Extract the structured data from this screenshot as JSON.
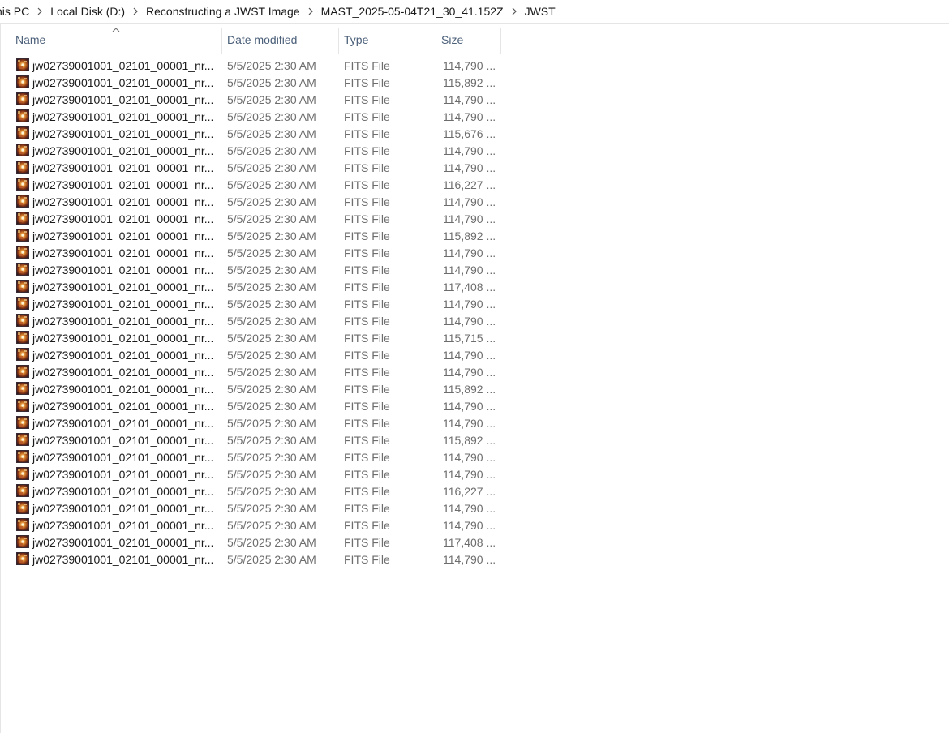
{
  "breadcrumb": [
    {
      "label": "his PC"
    },
    {
      "label": "Local Disk (D:)"
    },
    {
      "label": "Reconstructing a JWST Image"
    },
    {
      "label": "MAST_2025-05-04T21_30_41.152Z"
    },
    {
      "label": "JWST"
    }
  ],
  "columns": {
    "name": "Name",
    "date": "Date modified",
    "type": "Type",
    "size": "Size",
    "sort_indicator": "ascending"
  },
  "icon": "fits-file-icon",
  "files": [
    {
      "name": "jw02739001001_02101_00001_nr...",
      "date": "5/5/2025 2:30 AM",
      "type": "FITS File",
      "size": "114,790 ..."
    },
    {
      "name": "jw02739001001_02101_00001_nr...",
      "date": "5/5/2025 2:30 AM",
      "type": "FITS File",
      "size": "115,892 ..."
    },
    {
      "name": "jw02739001001_02101_00001_nr...",
      "date": "5/5/2025 2:30 AM",
      "type": "FITS File",
      "size": "114,790 ..."
    },
    {
      "name": "jw02739001001_02101_00001_nr...",
      "date": "5/5/2025 2:30 AM",
      "type": "FITS File",
      "size": "114,790 ..."
    },
    {
      "name": "jw02739001001_02101_00001_nr...",
      "date": "5/5/2025 2:30 AM",
      "type": "FITS File",
      "size": "115,676 ..."
    },
    {
      "name": "jw02739001001_02101_00001_nr...",
      "date": "5/5/2025 2:30 AM",
      "type": "FITS File",
      "size": "114,790 ..."
    },
    {
      "name": "jw02739001001_02101_00001_nr...",
      "date": "5/5/2025 2:30 AM",
      "type": "FITS File",
      "size": "114,790 ..."
    },
    {
      "name": "jw02739001001_02101_00001_nr...",
      "date": "5/5/2025 2:30 AM",
      "type": "FITS File",
      "size": "116,227 ..."
    },
    {
      "name": "jw02739001001_02101_00001_nr...",
      "date": "5/5/2025 2:30 AM",
      "type": "FITS File",
      "size": "114,790 ..."
    },
    {
      "name": "jw02739001001_02101_00001_nr...",
      "date": "5/5/2025 2:30 AM",
      "type": "FITS File",
      "size": "114,790 ..."
    },
    {
      "name": "jw02739001001_02101_00001_nr...",
      "date": "5/5/2025 2:30 AM",
      "type": "FITS File",
      "size": "115,892 ..."
    },
    {
      "name": "jw02739001001_02101_00001_nr...",
      "date": "5/5/2025 2:30 AM",
      "type": "FITS File",
      "size": "114,790 ..."
    },
    {
      "name": "jw02739001001_02101_00001_nr...",
      "date": "5/5/2025 2:30 AM",
      "type": "FITS File",
      "size": "114,790 ..."
    },
    {
      "name": "jw02739001001_02101_00001_nr...",
      "date": "5/5/2025 2:30 AM",
      "type": "FITS File",
      "size": "117,408 ..."
    },
    {
      "name": "jw02739001001_02101_00001_nr...",
      "date": "5/5/2025 2:30 AM",
      "type": "FITS File",
      "size": "114,790 ..."
    },
    {
      "name": "jw02739001001_02101_00001_nr...",
      "date": "5/5/2025 2:30 AM",
      "type": "FITS File",
      "size": "114,790 ..."
    },
    {
      "name": "jw02739001001_02101_00001_nr...",
      "date": "5/5/2025 2:30 AM",
      "type": "FITS File",
      "size": "115,715 ..."
    },
    {
      "name": "jw02739001001_02101_00001_nr...",
      "date": "5/5/2025 2:30 AM",
      "type": "FITS File",
      "size": "114,790 ..."
    },
    {
      "name": "jw02739001001_02101_00001_nr...",
      "date": "5/5/2025 2:30 AM",
      "type": "FITS File",
      "size": "114,790 ..."
    },
    {
      "name": "jw02739001001_02101_00001_nr...",
      "date": "5/5/2025 2:30 AM",
      "type": "FITS File",
      "size": "115,892 ..."
    },
    {
      "name": "jw02739001001_02101_00001_nr...",
      "date": "5/5/2025 2:30 AM",
      "type": "FITS File",
      "size": "114,790 ..."
    },
    {
      "name": "jw02739001001_02101_00001_nr...",
      "date": "5/5/2025 2:30 AM",
      "type": "FITS File",
      "size": "114,790 ..."
    },
    {
      "name": "jw02739001001_02101_00001_nr...",
      "date": "5/5/2025 2:30 AM",
      "type": "FITS File",
      "size": "115,892 ..."
    },
    {
      "name": "jw02739001001_02101_00001_nr...",
      "date": "5/5/2025 2:30 AM",
      "type": "FITS File",
      "size": "114,790 ..."
    },
    {
      "name": "jw02739001001_02101_00001_nr...",
      "date": "5/5/2025 2:30 AM",
      "type": "FITS File",
      "size": "114,790 ..."
    },
    {
      "name": "jw02739001001_02101_00001_nr...",
      "date": "5/5/2025 2:30 AM",
      "type": "FITS File",
      "size": "116,227 ..."
    },
    {
      "name": "jw02739001001_02101_00001_nr...",
      "date": "5/5/2025 2:30 AM",
      "type": "FITS File",
      "size": "114,790 ..."
    },
    {
      "name": "jw02739001001_02101_00001_nr...",
      "date": "5/5/2025 2:30 AM",
      "type": "FITS File",
      "size": "114,790 ..."
    },
    {
      "name": "jw02739001001_02101_00001_nr...",
      "date": "5/5/2025 2:30 AM",
      "type": "FITS File",
      "size": "117,408 ..."
    },
    {
      "name": "jw02739001001_02101_00001_nr...",
      "date": "5/5/2025 2:30 AM",
      "type": "FITS File",
      "size": "114,790 ..."
    }
  ]
}
